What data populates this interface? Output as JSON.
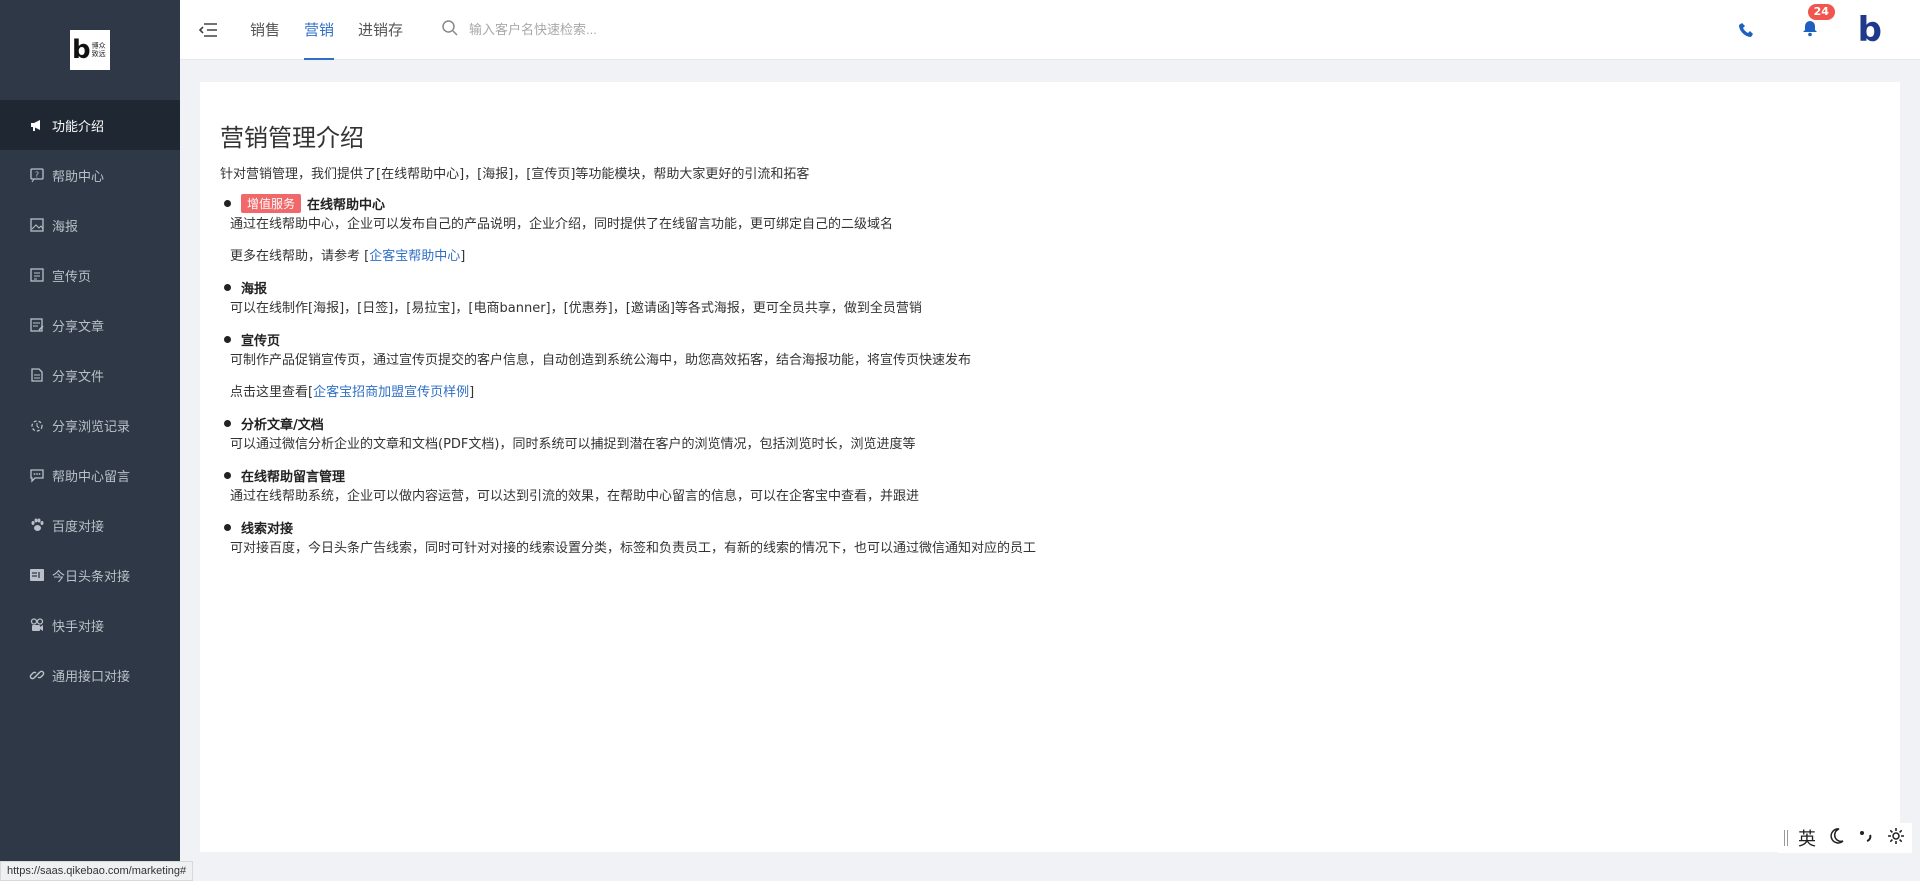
{
  "logo": {
    "mark": "b",
    "line1": "博众",
    "line2": "致远"
  },
  "sidebar": {
    "items": [
      {
        "label": "功能介绍",
        "icon": "megaphone-icon",
        "active": true
      },
      {
        "label": "帮助中心",
        "icon": "help-icon"
      },
      {
        "label": "海报",
        "icon": "image-icon"
      },
      {
        "label": "宣传页",
        "icon": "page-icon"
      },
      {
        "label": "分享文章",
        "icon": "article-icon"
      },
      {
        "label": "分享文件",
        "icon": "file-icon"
      },
      {
        "label": "分享浏览记录",
        "icon": "history-icon"
      },
      {
        "label": "帮助中心留言",
        "icon": "message-icon"
      },
      {
        "label": "百度对接",
        "icon": "paw-icon"
      },
      {
        "label": "今日头条对接",
        "icon": "toutiao-icon"
      },
      {
        "label": "快手对接",
        "icon": "kuaishou-icon"
      },
      {
        "label": "通用接口对接",
        "icon": "link-icon"
      }
    ]
  },
  "header": {
    "tabs": [
      {
        "label": "销售"
      },
      {
        "label": "营销",
        "active": true
      },
      {
        "label": "进销存"
      }
    ],
    "search_placeholder": "输入客户名快速检索...",
    "notification_count": "24",
    "brand_mark": "b"
  },
  "main": {
    "title": "营销管理介绍",
    "intro": "针对营销管理，我们提供了[在线帮助中心]，[海报]，[宣传页]等功能模块，帮助大家更好的引流和拓客",
    "sections": [
      {
        "tag": "增值服务",
        "title": "在线帮助中心",
        "desc": "通过在线帮助中心，企业可以发布自己的产品说明，企业介绍，同时提供了在线留言功能，更可绑定自己的二级域名",
        "link_prefix": "更多在线帮助，请参考 [",
        "link_text": "企客宝帮助中心",
        "link_suffix": "]"
      },
      {
        "title": "海报",
        "desc": "可以在线制作[海报]，[日签]，[易拉宝]，[电商banner]，[优惠券]，[邀请函]等各式海报，更可全员共享，做到全员营销"
      },
      {
        "title": "宣传页",
        "desc": "可制作产品促销宣传页，通过宣传页提交的客户信息，自动创造到系统公海中，助您高效拓客，结合海报功能，将宣传页快速发布",
        "link_prefix": "点击这里查看[",
        "link_text": "企客宝招商加盟宣传页样例",
        "link_suffix": "]"
      },
      {
        "title": "分析文章/文档",
        "desc": "可以通过微信分析企业的文章和文档(PDF文档)，同时系统可以捕捉到潜在客户的浏览情况，包括浏览时长，浏览进度等"
      },
      {
        "title": "在线帮助留言管理",
        "desc": "通过在线帮助系统，企业可以做内容运营，可以达到引流的效果，在帮助中心留言的信息，可以在企客宝中查看，并跟进"
      },
      {
        "title": "线索对接",
        "desc": "可对接百度，今日头条广告线索，同时可针对对接的线索设置分类，标签和负责员工，有新的线索的情况下，也可以通过微信通知对应的员工"
      }
    ]
  },
  "status_bar": {
    "url": "https://saas.qikebao.com/marketing#"
  },
  "ime": {
    "lang": "英"
  },
  "colors": {
    "sidebar_bg": "#2e3846",
    "accent": "#2f6fc6",
    "tag": "#f0686a",
    "badge": "#f0564e"
  }
}
